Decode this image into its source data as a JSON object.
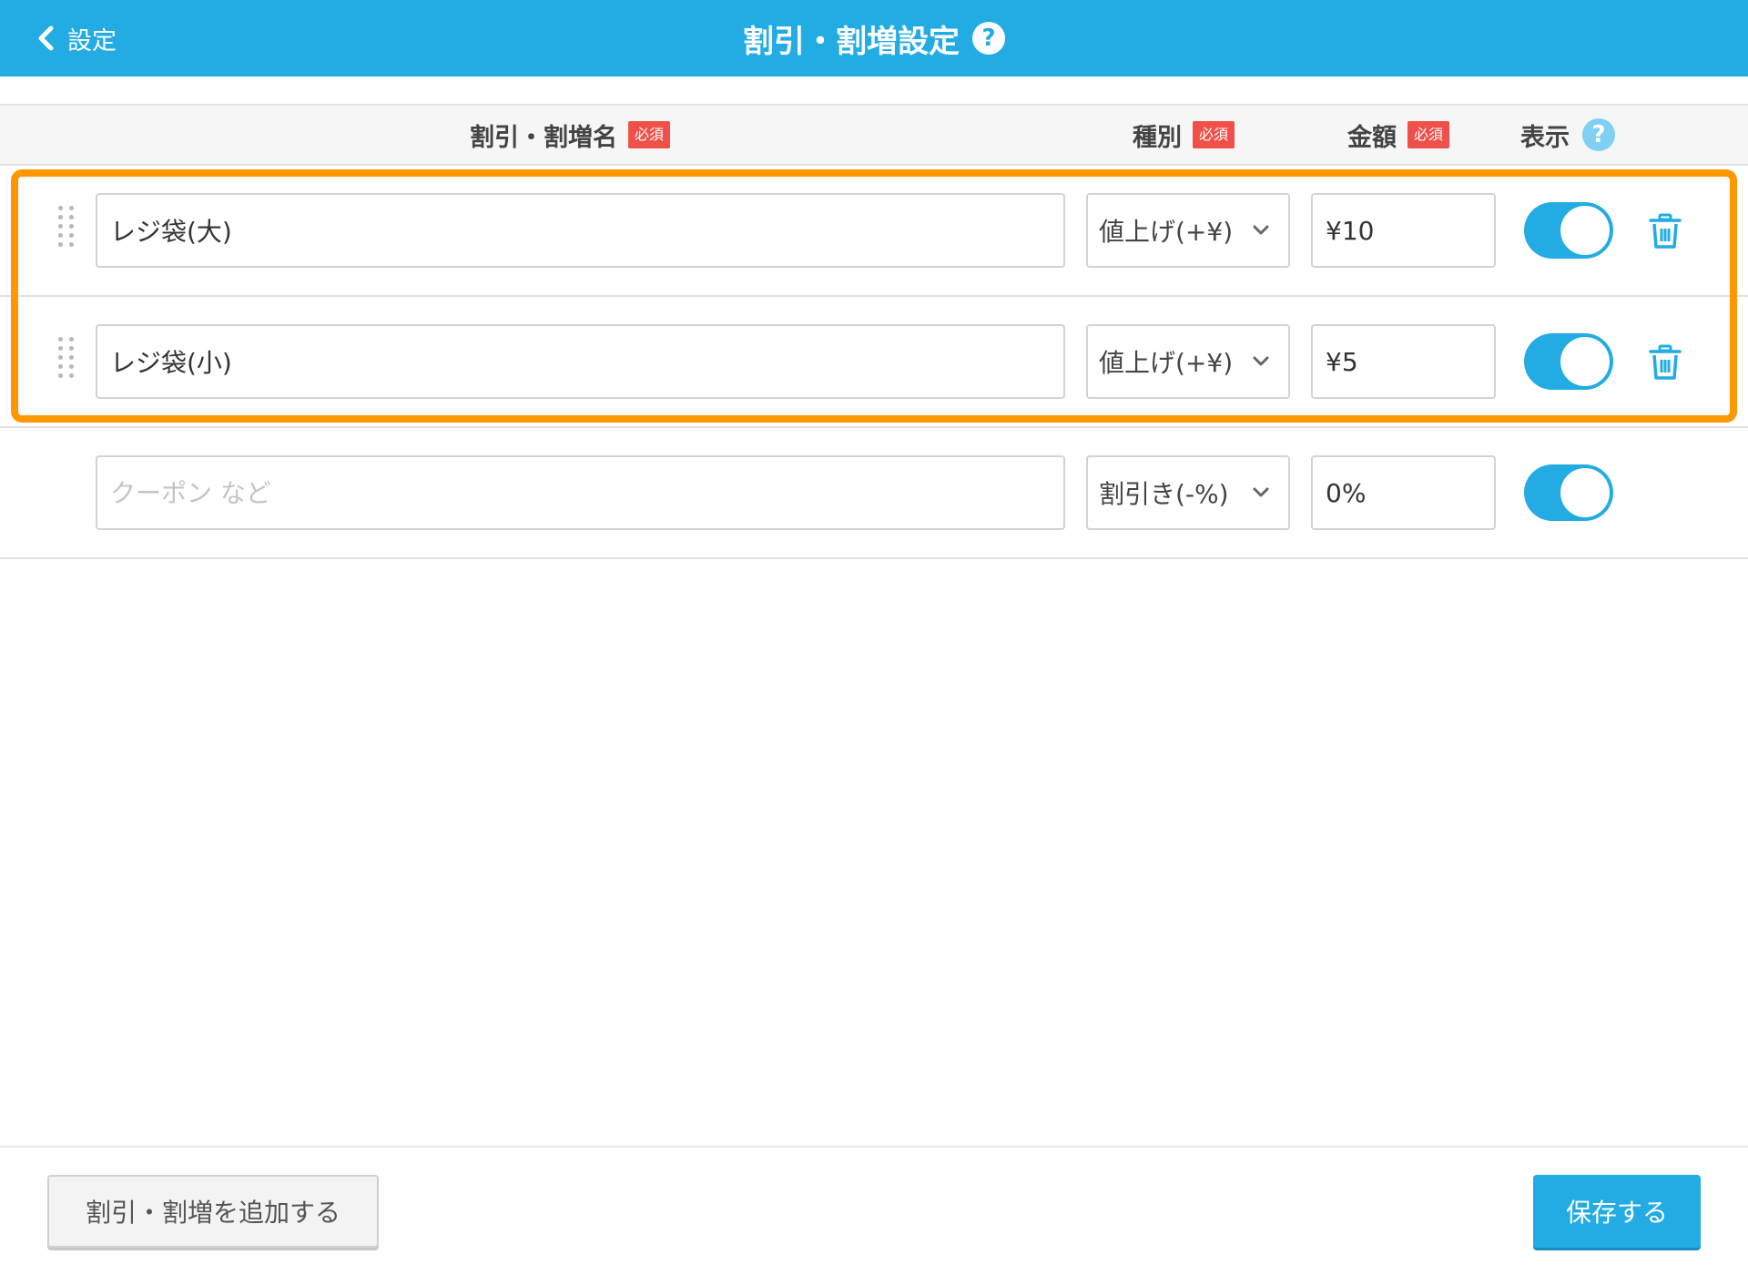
{
  "header": {
    "back_label": "設定",
    "title": "割引・割増設定",
    "help_glyph": "?"
  },
  "columns": {
    "name": {
      "label": "割引・割増名",
      "badge": "必須"
    },
    "type": {
      "label": "種別",
      "badge": "必須"
    },
    "amount": {
      "label": "金額",
      "badge": "必須"
    },
    "display": {
      "label": "表示",
      "help_glyph": "?"
    }
  },
  "rows": [
    {
      "name": "レジ袋(大)",
      "type": "値上げ(+¥)",
      "amount": "¥10",
      "display_enabled": true
    },
    {
      "name": "レジ袋(小)",
      "type": "値上げ(+¥)",
      "amount": "¥5",
      "display_enabled": true
    }
  ],
  "new_row": {
    "name_placeholder": "クーポン など",
    "type": "割引き(-%)",
    "amount": "0%",
    "display_enabled": true
  },
  "footer": {
    "add_label": "割引・割増を追加する",
    "save_label": "保存する"
  },
  "colors": {
    "header_bg": "#22ace3",
    "required_badge": "#f0504a",
    "highlight": "#ff9800",
    "toggle_on": "#22ace3"
  },
  "icons": [
    "chevron-left-icon",
    "help-icon",
    "drag-handle-icon",
    "chevron-down-icon",
    "trash-icon"
  ]
}
